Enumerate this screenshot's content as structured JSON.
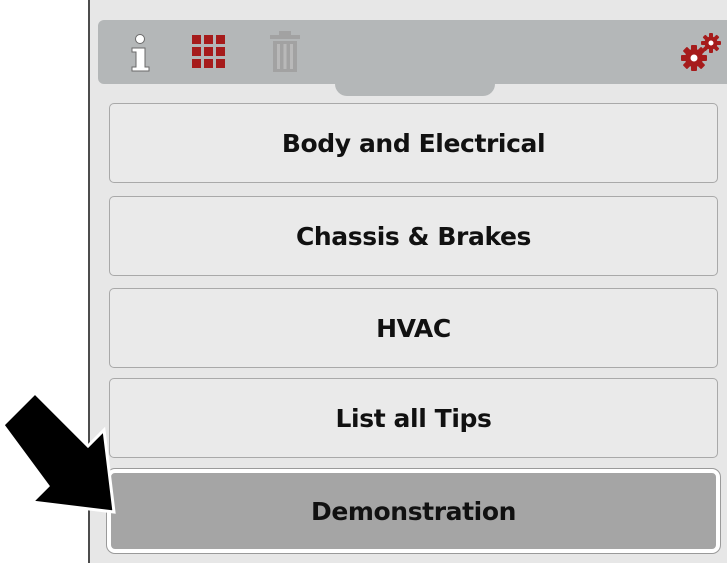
{
  "toolbar": {
    "icons": [
      "info-icon",
      "grid-icon",
      "trash-icon",
      "settings-icon"
    ],
    "colors": {
      "accent": "#a61b1b",
      "icon_white": "#ffffff",
      "icon_disabled": "#9a9a9a",
      "bar": "#b4b7b8"
    }
  },
  "menu": {
    "items": [
      {
        "label": "Body and Electrical",
        "selected": false
      },
      {
        "label": "Chassis & Brakes",
        "selected": false
      },
      {
        "label": "HVAC",
        "selected": false
      },
      {
        "label": "List all Tips",
        "selected": false
      },
      {
        "label": "Demonstration",
        "selected": true
      }
    ]
  },
  "annotation": {
    "icon": "pointer-arrow-icon",
    "color": "#000000"
  }
}
